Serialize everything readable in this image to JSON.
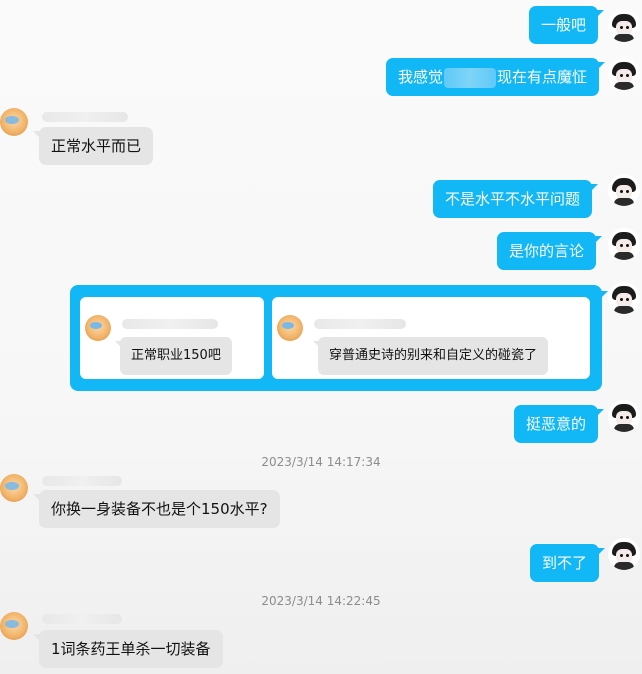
{
  "messages": {
    "m1": "一般吧",
    "m2_before": "我感觉",
    "m2_after": "现在有点魔怔",
    "m3": "正常水平而已",
    "m4": "不是水平不水平问题",
    "m5": "是你的言论",
    "m6": "挺恶意的",
    "m7": "你换一身装备不也是个150水平?",
    "m8": "到不了",
    "m9": "1词条药王单杀一切装备"
  },
  "forwarded": {
    "left_msg": "正常职业150吧",
    "right_msg": "穿普通史诗的别来和自定义的碰瓷了"
  },
  "timestamps": {
    "t1": "2023/3/14 14:17:34",
    "t2": "2023/3/14 14:22:45"
  },
  "colors": {
    "self_bubble": "#12b7f5",
    "other_bubble": "#e5e5e5",
    "timestamp_text": "#8c8c8c"
  }
}
